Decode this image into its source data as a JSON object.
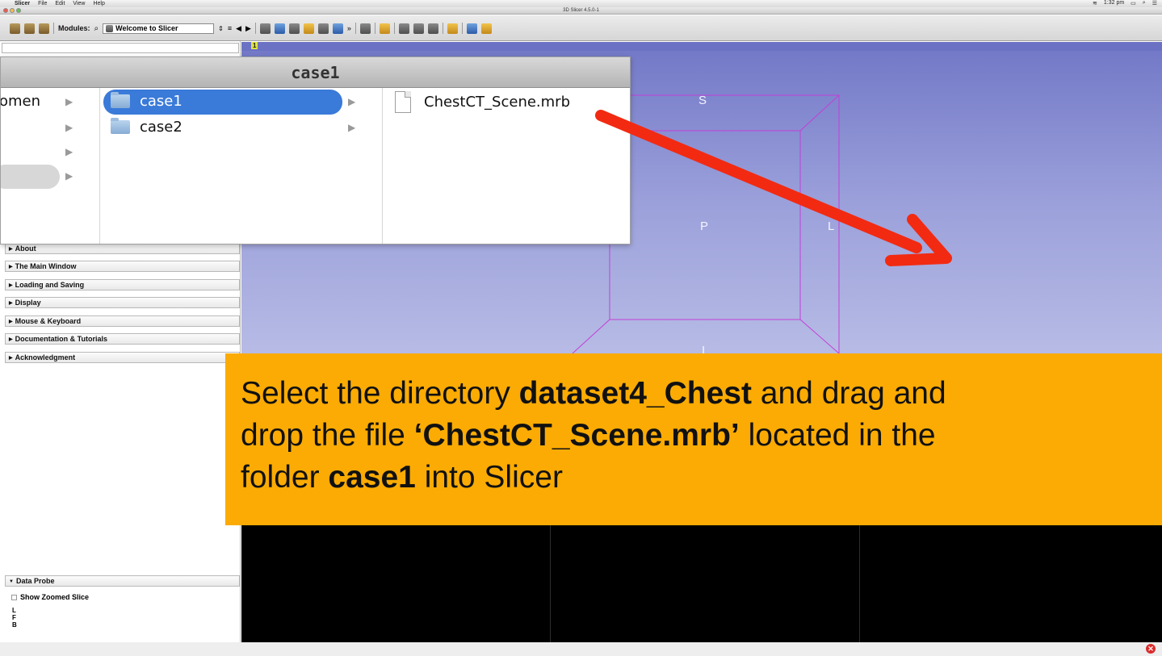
{
  "menubar": {
    "app": "Slicer",
    "items": [
      "File",
      "Edit",
      "View",
      "Help"
    ],
    "clock": "1:32 pm"
  },
  "window": {
    "title": "3D Slicer 4.5.0-1"
  },
  "toolbar": {
    "modules_label": "Modules:",
    "module_selected": "Welcome to Slicer",
    "layout_number": "1"
  },
  "finder": {
    "title": "case1",
    "col1_partial_item": "omen",
    "col2_items": [
      "case1",
      "case2"
    ],
    "col3_items": [
      "ChestCT_Scene.mrb"
    ]
  },
  "sections": [
    "About",
    "The Main Window",
    "Loading and Saving",
    "Display",
    "Mouse & Keyboard",
    "Documentation & Tutorials",
    "Acknowledgment"
  ],
  "data_probe": {
    "title": "Data Probe",
    "show_zoomed": "Show Zoomed Slice",
    "coords": [
      "L",
      "F",
      "B"
    ]
  },
  "view3d": {
    "labels": {
      "s": "S",
      "p": "P",
      "l": "L",
      "i": "I"
    }
  },
  "banner": {
    "t1": "Select the directory ",
    "b1": "dataset4_Chest",
    "t2": " and drag and",
    "t3": "drop the file ",
    "b2": "‘ChestCT_Scene.mrb’",
    "t4": " located in the",
    "t5": "folder ",
    "b3": "case1",
    "t6": " into Slicer"
  },
  "colors": {
    "banner": "#fbab03",
    "arrow": "#f22a12",
    "view_top": "#7177c6",
    "view_bottom": "#b7bbe5",
    "selection": "#3a7ad9",
    "box_lines": "#c23fd6"
  }
}
